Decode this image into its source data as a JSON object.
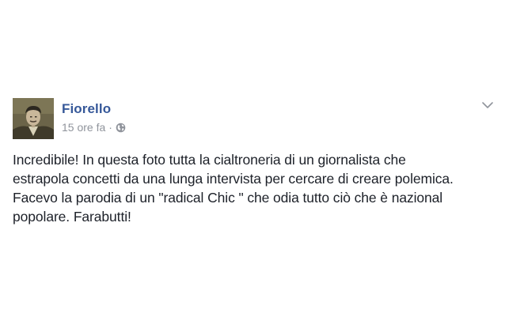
{
  "post": {
    "author": "Fiorello",
    "timestamp": "15 ore fa",
    "separator": "·",
    "audience_icon": "globe-icon",
    "menu_icon": "chevron-down-icon",
    "text_lines": [
      "Incredibile! In questa foto tutta la cialtroneria di un giornalista che",
      "estrapola concetti da una lunga intervista per cercare di creare polemica.",
      "Facevo la parodia di un \"radical Chic \" che odia tutto ciò che è nazional",
      "popolare. Farabutti!"
    ]
  },
  "colors": {
    "author_link": "#365899",
    "meta_text": "#90949c",
    "body_text": "#1d2129",
    "background": "#ffffff"
  }
}
